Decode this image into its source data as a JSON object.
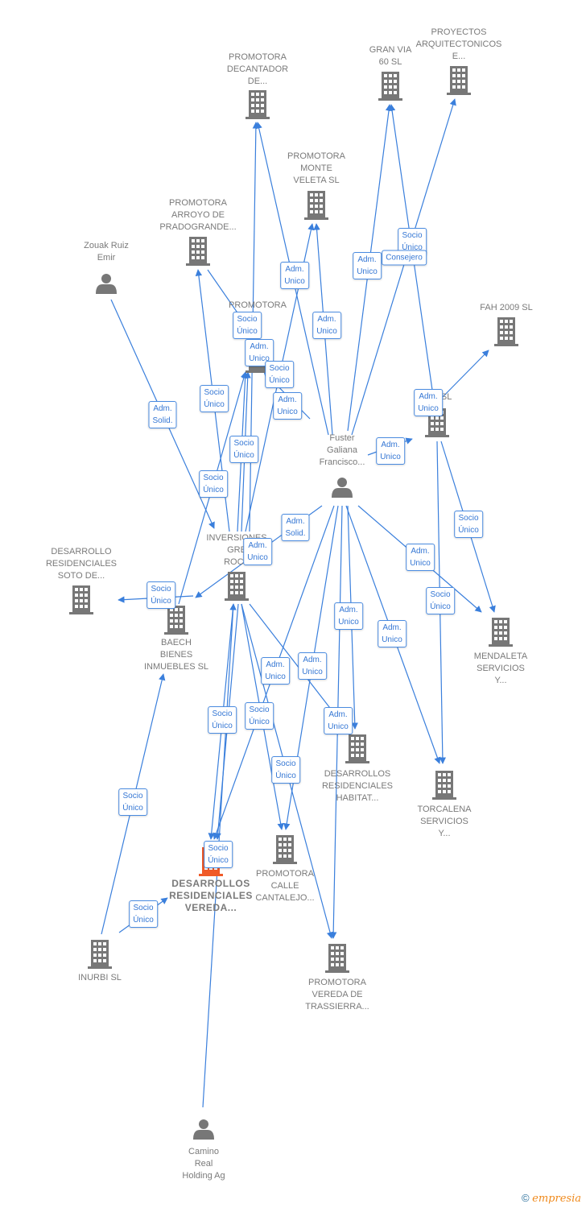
{
  "colors": {
    "edge": "#3a7fdc",
    "node": "#777777",
    "highlight": "#f05a28",
    "box_text": "#3577d4"
  },
  "nodes": [
    {
      "id": "decantador",
      "type": "company",
      "lines": [
        "PROMOTORA",
        "DECANTADOR",
        "DE..."
      ]
    },
    {
      "id": "granvia",
      "type": "company",
      "lines": [
        "GRAN VIA",
        "60 SL"
      ]
    },
    {
      "id": "proyectos",
      "type": "company",
      "lines": [
        "PROYECTOS",
        "ARQUITECTONICOS",
        "E..."
      ]
    },
    {
      "id": "monteveleta",
      "type": "company",
      "lines": [
        "PROMOTORA",
        "MONTE",
        "VELETA  SL"
      ]
    },
    {
      "id": "arroyo",
      "type": "company",
      "lines": [
        "PROMOTORA",
        "ARROYO DE",
        "PRADOGRANDE..."
      ]
    },
    {
      "id": "zouak",
      "type": "person",
      "lines": [
        "Zouak Ruiz",
        "Emir"
      ]
    },
    {
      "id": "fah",
      "type": "company",
      "lines": [
        "FAH 2009 SL"
      ]
    },
    {
      "id": "promotora_a",
      "type": "company",
      "lines": [
        "PROMOTORA",
        "A"
      ]
    },
    {
      "id": "wz",
      "type": "company",
      "lines": [
        "W        Z  SL"
      ]
    },
    {
      "id": "fuster",
      "type": "person",
      "lines": [
        "Fuster",
        "Galiana",
        "Francisco..."
      ]
    },
    {
      "id": "inversiones",
      "type": "company",
      "lines": [
        "INVERSIONES",
        "GRE",
        "ROCK"
      ]
    },
    {
      "id": "soto",
      "type": "company",
      "lines": [
        "DESARROLLO",
        "RESIDENCIALES",
        "SOTO DE..."
      ]
    },
    {
      "id": "baech",
      "type": "company",
      "lines": [
        "BAECH",
        "BIENES",
        "INMUEBLES SL"
      ]
    },
    {
      "id": "mendaleta",
      "type": "company",
      "lines": [
        "MENDALETA",
        "SERVICIOS",
        "Y..."
      ]
    },
    {
      "id": "habitat",
      "type": "company",
      "lines": [
        "DESARROLLOS",
        "RESIDENCIALES",
        "HABITAT..."
      ]
    },
    {
      "id": "torcalena",
      "type": "company",
      "lines": [
        "TORCALENA",
        "SERVICIOS",
        "Y..."
      ]
    },
    {
      "id": "vereda",
      "type": "company",
      "highlight": true,
      "lines": [
        "DESARROLLOS",
        "RESIDENCIALES",
        "VEREDA..."
      ]
    },
    {
      "id": "cantalejo",
      "type": "company",
      "lines": [
        "PROMOTORA",
        "CALLE",
        "CANTALEJO..."
      ]
    },
    {
      "id": "inurbi",
      "type": "company",
      "lines": [
        "INURBI SL"
      ]
    },
    {
      "id": "trassierra",
      "type": "company",
      "lines": [
        "PROMOTORA",
        "VEREDA DE",
        "TRASSIERRA..."
      ]
    },
    {
      "id": "camino",
      "type": "person",
      "lines": [
        "Camino",
        "Real",
        "Holding Ag"
      ]
    }
  ],
  "edge_labels": [
    [
      "Adm.",
      "Unico"
    ],
    [
      "Adm.",
      "Unico"
    ],
    [
      "Socio",
      "Único"
    ],
    [
      "Consejero"
    ],
    [
      "Adm.",
      "Unico"
    ],
    [
      "Socio",
      "Único"
    ],
    [
      "Adm.",
      "Unico"
    ],
    [
      "Socio",
      "Único"
    ],
    [
      "Adm.",
      "Unico"
    ],
    [
      "Adm.",
      "Solid."
    ],
    [
      "Socio",
      "Único"
    ],
    [
      "Socio",
      "Único"
    ],
    [
      "Socio",
      "Único"
    ],
    [
      "Adm.",
      "Unico"
    ],
    [
      "Adm.",
      "Unico"
    ],
    [
      "Adm.",
      "Solid."
    ],
    [
      "Adm.",
      "Unico"
    ],
    [
      "Adm.",
      "Unico"
    ],
    [
      "Socio",
      "Único"
    ],
    [
      "Socio",
      "Único"
    ],
    [
      "Socio",
      "Único"
    ],
    [
      "Adm.",
      "Unico"
    ],
    [
      "Adm.",
      "Unico"
    ],
    [
      "Adm.",
      "Unico"
    ],
    [
      "Adm.",
      "Unico"
    ],
    [
      "Socio",
      "Único"
    ],
    [
      "Socio",
      "Único"
    ],
    [
      "Adm.",
      "Unico"
    ],
    [
      "Socio",
      "Único"
    ],
    [
      "Socio",
      "Único"
    ],
    [
      "Socio",
      "Único"
    ],
    [
      "Socio",
      "Único"
    ]
  ],
  "footer": {
    "copyright": "©",
    "brand": "empresia"
  }
}
